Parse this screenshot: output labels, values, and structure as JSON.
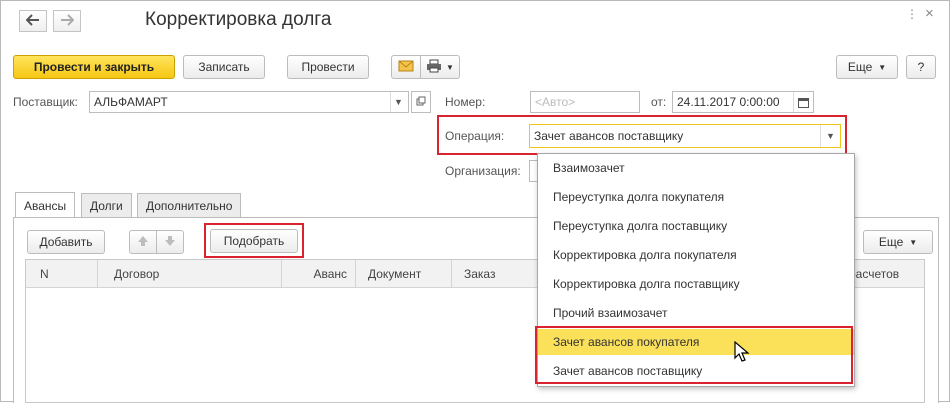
{
  "window": {
    "title": "Корректировка долга",
    "back_glyph": "🡐",
    "forward_glyph": "🡒"
  },
  "toolbar": {
    "post_close_label": "Провести и закрыть",
    "save_label": "Записать",
    "post_label": "Провести",
    "more_label": "Еще",
    "help_label": "?",
    "email_icon": "envelope-icon",
    "print_icon": "printer-icon"
  },
  "form": {
    "supplier_label": "Поставщик:",
    "supplier_value": "АЛЬФАМАРТ",
    "number_label": "Номер:",
    "number_placeholder": "<Авто>",
    "date_label": "от:",
    "date_value": "24.11.2017  0:00:00",
    "operation_label": "Операция:",
    "operation_value": "Зачет авансов поставщику",
    "organization_label": "Организация:"
  },
  "tabs": [
    {
      "label": "Авансы",
      "active": true
    },
    {
      "label": "Долги",
      "active": false
    },
    {
      "label": "Дополнительно",
      "active": false
    }
  ],
  "table_toolbar": {
    "add_label": "Добавить",
    "pick_label": "Подобрать",
    "more_label": "Еще"
  },
  "table": {
    "columns": [
      "N",
      "Договор",
      "Аванс",
      "Документ",
      "Заказ",
      "расчетов"
    ]
  },
  "operation_dropdown": {
    "items": [
      "Взаимозачет",
      "Переуступка долга покупателя",
      "Переуступка долга поставщику",
      "Корректировка долга покупателя",
      "Корректировка долга поставщику",
      "Прочий взаимозачет",
      "Зачет авансов покупателя",
      "Зачет авансов поставщику"
    ],
    "hovered_index": 6
  },
  "colors": {
    "primary_button": "#f6c714",
    "highlight": "#d9232e",
    "hover_item": "#fbe15a"
  }
}
